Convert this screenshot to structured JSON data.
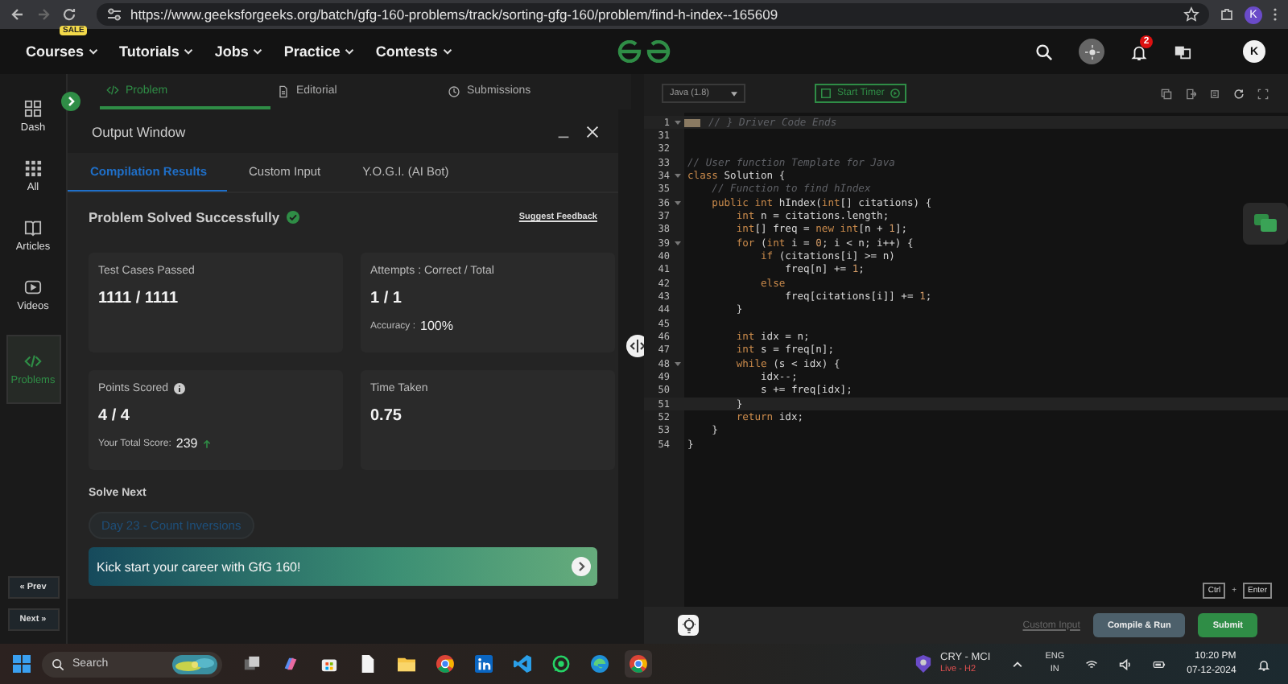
{
  "browser": {
    "url": "https://www.geeksforgeeks.org/batch/gfg-160-problems/track/sorting-gfg-160/problem/find-h-index--165609",
    "avatar": "K"
  },
  "nav": {
    "sale_badge": "SALE",
    "menu": [
      "Courses",
      "Tutorials",
      "Jobs",
      "Practice",
      "Contests"
    ],
    "notifications": "2",
    "avatar": "K"
  },
  "sidebar": {
    "items": [
      {
        "label": "Dash",
        "kind": "dash",
        "selected": false
      },
      {
        "label": "All",
        "kind": "all",
        "selected": false
      },
      {
        "label": "Articles",
        "kind": "articles",
        "selected": false
      },
      {
        "label": "Videos",
        "kind": "videos",
        "selected": false
      },
      {
        "label": "Problems",
        "kind": "problems",
        "selected": true
      }
    ],
    "prev": "« Prev",
    "next": "Next »"
  },
  "problem_tabs": [
    {
      "label": "Problem",
      "kind": "code",
      "selected": true
    },
    {
      "label": "Editorial",
      "kind": "doc",
      "selected": false
    },
    {
      "label": "Submissions",
      "kind": "clock",
      "selected": false
    }
  ],
  "output_window": {
    "title": "Output Window",
    "tabs": [
      {
        "label": "Compilation Results",
        "selected": true
      },
      {
        "label": "Custom Input",
        "selected": false
      },
      {
        "label": "Y.O.G.I. (AI Bot)",
        "selected": false
      }
    ],
    "status": "Problem Solved Successfully",
    "feedback_link": "Suggest Feedback",
    "cards": [
      {
        "label": "Test Cases Passed",
        "value": "1111 / 1111",
        "info": false
      },
      {
        "label": "Attempts : Correct / Total",
        "value": "1 / 1",
        "info": false,
        "note": {
          "label": "Accuracy :",
          "value": "100%",
          "rising": false
        }
      },
      {
        "label": "Points Scored",
        "value": "4 / 4",
        "info": true,
        "note": {
          "label": "Your Total Score:",
          "value": "239",
          "rising": true
        }
      },
      {
        "label": "Time Taken",
        "value": "0.75",
        "info": false
      }
    ],
    "solve_next": {
      "heading": "Solve Next",
      "chip": "Day 23 - Count Inversions"
    },
    "banner": "Kick start your career with GfG 160!"
  },
  "editor": {
    "language": "Java (1.8)",
    "timer_button": "Start Timer",
    "lines": [
      {
        "num": "1",
        "foldable": true,
        "folded": true,
        "highlighted": true,
        "tokens": [
          {
            "kind": "comment",
            "text": "// } Driver Code Ends"
          }
        ]
      },
      {
        "num": "31",
        "foldable": false,
        "folded": false,
        "highlighted": false
      },
      {
        "num": "32",
        "foldable": false,
        "folded": false,
        "highlighted": false
      },
      {
        "num": "33",
        "foldable": false,
        "folded": false,
        "highlighted": false,
        "tokens": [
          {
            "kind": "comment",
            "text": "// User function Template for Java"
          }
        ]
      },
      {
        "num": "34",
        "foldable": true,
        "folded": false,
        "highlighted": false,
        "tokens": [
          {
            "kind": "kw",
            "text": "class"
          },
          {
            "kind": "plain",
            "text": " Solution {"
          }
        ]
      },
      {
        "num": "35",
        "foldable": false,
        "folded": false,
        "highlighted": false,
        "tokens": [
          {
            "kind": "comment",
            "text": "    // Function to find hIndex"
          }
        ]
      },
      {
        "num": "36",
        "foldable": true,
        "folded": false,
        "highlighted": false,
        "tokens": [
          {
            "kind": "kw",
            "text": "    public int"
          },
          {
            "kind": "plain",
            "text": " hIndex("
          },
          {
            "kind": "kw",
            "text": "int"
          },
          {
            "kind": "plain",
            "text": "[] citations) {"
          }
        ]
      },
      {
        "num": "37",
        "foldable": false,
        "folded": false,
        "highlighted": false,
        "tokens": [
          {
            "kind": "kw",
            "text": "        int"
          },
          {
            "kind": "plain",
            "text": " n = citations.length;"
          }
        ]
      },
      {
        "num": "38",
        "foldable": false,
        "folded": false,
        "highlighted": false,
        "tokens": [
          {
            "kind": "kw",
            "text": "        int"
          },
          {
            "kind": "plain",
            "text": "[] freq = "
          },
          {
            "kind": "kw",
            "text": "new int"
          },
          {
            "kind": "plain",
            "text": "[n + "
          },
          {
            "kind": "num",
            "text": "1"
          },
          {
            "kind": "plain",
            "text": "];"
          }
        ]
      },
      {
        "num": "39",
        "foldable": true,
        "folded": false,
        "highlighted": false,
        "tokens": [
          {
            "kind": "kw",
            "text": "        for"
          },
          {
            "kind": "plain",
            "text": " ("
          },
          {
            "kind": "kw",
            "text": "int"
          },
          {
            "kind": "plain",
            "text": " i = "
          },
          {
            "kind": "num",
            "text": "0"
          },
          {
            "kind": "plain",
            "text": "; i < n; i++) {"
          }
        ]
      },
      {
        "num": "40",
        "foldable": false,
        "folded": false,
        "highlighted": false,
        "tokens": [
          {
            "kind": "kw",
            "text": "            if"
          },
          {
            "kind": "plain",
            "text": " (citations[i] >= n)"
          }
        ]
      },
      {
        "num": "41",
        "foldable": false,
        "folded": false,
        "highlighted": false,
        "tokens": [
          {
            "kind": "plain",
            "text": "                freq[n] += "
          },
          {
            "kind": "num",
            "text": "1"
          },
          {
            "kind": "plain",
            "text": ";"
          }
        ]
      },
      {
        "num": "42",
        "foldable": false,
        "folded": false,
        "highlighted": false,
        "tokens": [
          {
            "kind": "kw",
            "text": "            else"
          }
        ]
      },
      {
        "num": "43",
        "foldable": false,
        "folded": false,
        "highlighted": false,
        "tokens": [
          {
            "kind": "plain",
            "text": "                freq[citations[i]] += "
          },
          {
            "kind": "num",
            "text": "1"
          },
          {
            "kind": "plain",
            "text": ";"
          }
        ]
      },
      {
        "num": "44",
        "foldable": false,
        "folded": false,
        "highlighted": false,
        "tokens": [
          {
            "kind": "plain",
            "text": "        }"
          }
        ]
      },
      {
        "num": "45",
        "foldable": false,
        "folded": false,
        "highlighted": false
      },
      {
        "num": "46",
        "foldable": false,
        "folded": false,
        "highlighted": false,
        "tokens": [
          {
            "kind": "kw",
            "text": "        int"
          },
          {
            "kind": "plain",
            "text": " idx = n;"
          }
        ]
      },
      {
        "num": "47",
        "foldable": false,
        "folded": false,
        "highlighted": false,
        "tokens": [
          {
            "kind": "kw",
            "text": "        int"
          },
          {
            "kind": "plain",
            "text": " s = freq[n];"
          }
        ]
      },
      {
        "num": "48",
        "foldable": true,
        "folded": false,
        "highlighted": false,
        "tokens": [
          {
            "kind": "kw",
            "text": "        while"
          },
          {
            "kind": "plain",
            "text": " (s < idx) {"
          }
        ]
      },
      {
        "num": "49",
        "foldable": false,
        "folded": false,
        "highlighted": false,
        "tokens": [
          {
            "kind": "plain",
            "text": "            idx--;"
          }
        ]
      },
      {
        "num": "50",
        "foldable": false,
        "folded": false,
        "highlighted": false,
        "tokens": [
          {
            "kind": "plain",
            "text": "            s += freq[idx];"
          }
        ]
      },
      {
        "num": "51",
        "foldable": false,
        "folded": false,
        "highlighted": true,
        "tokens": [
          {
            "kind": "plain",
            "text": "        }"
          }
        ]
      },
      {
        "num": "52",
        "foldable": false,
        "folded": false,
        "highlighted": false,
        "tokens": [
          {
            "kind": "kw",
            "text": "        return"
          },
          {
            "kind": "plain",
            "text": " idx;"
          }
        ]
      },
      {
        "num": "53",
        "foldable": false,
        "folded": false,
        "highlighted": false,
        "tokens": [
          {
            "kind": "plain",
            "text": "    }"
          }
        ]
      },
      {
        "num": "54",
        "foldable": false,
        "folded": false,
        "highlighted": false,
        "tokens": [
          {
            "kind": "plain",
            "text": "}"
          }
        ]
      }
    ],
    "shortcut": {
      "keys": [
        "Ctrl",
        "Enter"
      ],
      "joiner": "+"
    },
    "custom_input": "Custom Input",
    "compile_button": "Compile & Run",
    "submit_button": "Submit"
  },
  "taskbar": {
    "search_placeholder": "Search",
    "match": "CRY - MCI",
    "match_status": "Live - H2",
    "language": [
      "ENG",
      "IN"
    ],
    "time": "10:20 PM",
    "date": "07-12-2024"
  }
}
